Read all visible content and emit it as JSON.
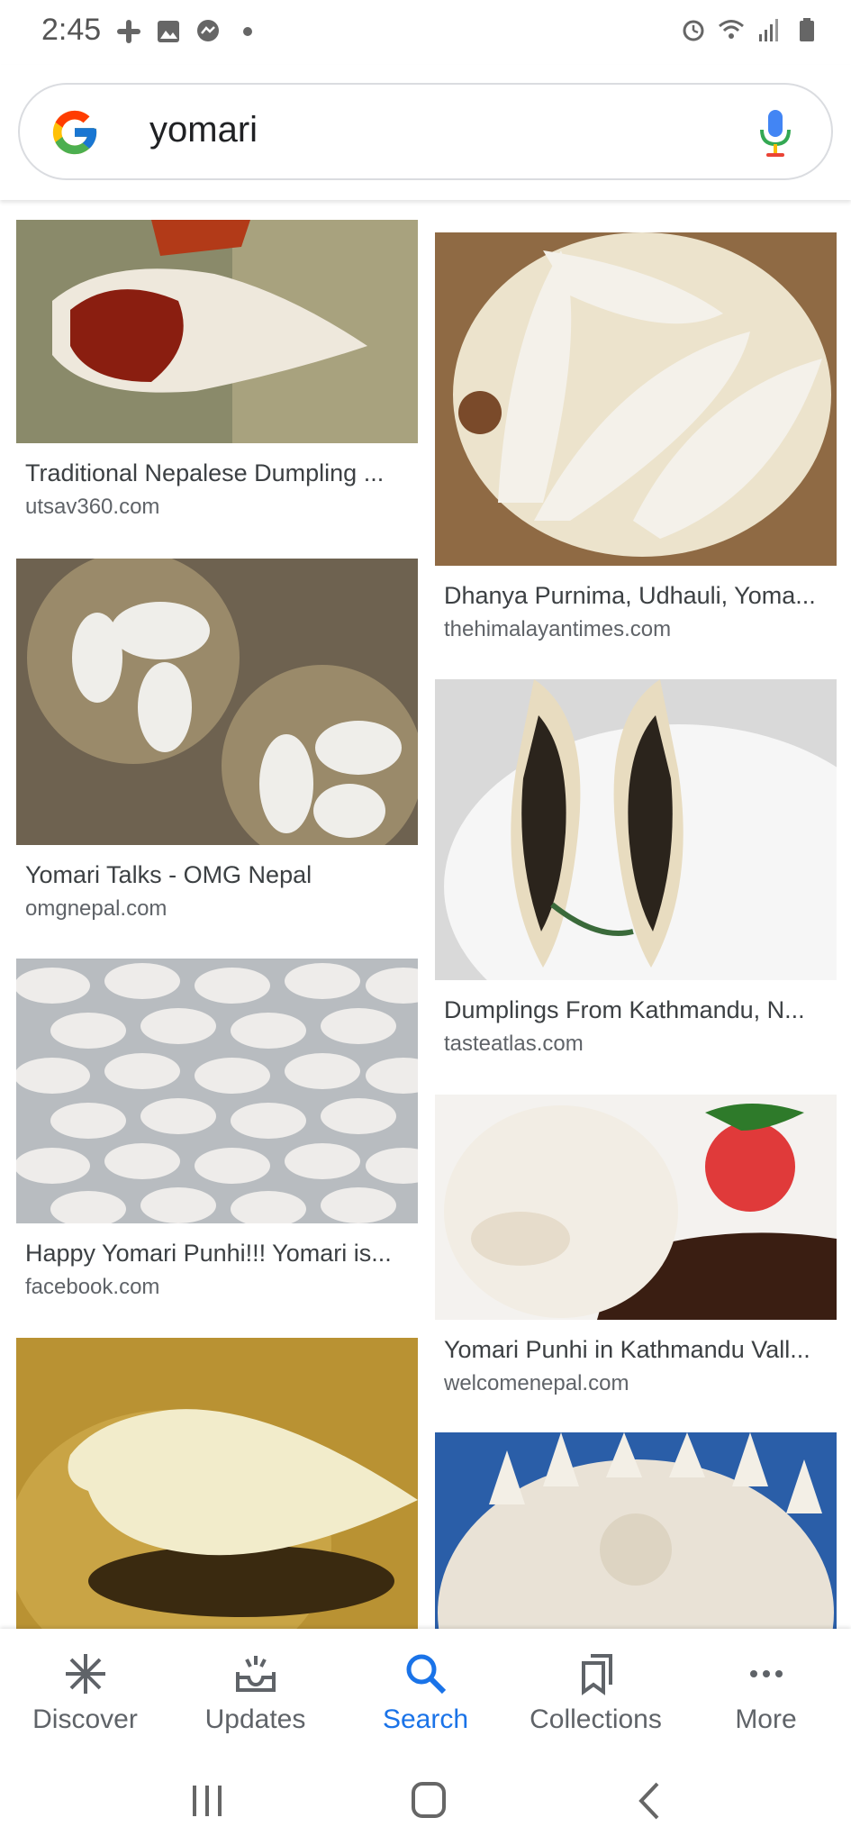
{
  "status_bar": {
    "time": "2:45",
    "left_icons": [
      "slack-icon",
      "gallery-icon",
      "messenger-icon",
      "dot-icon"
    ],
    "right_icons": [
      "alarm-icon",
      "wifi-icon",
      "signal-icon",
      "battery-icon"
    ]
  },
  "search": {
    "query": "yomari",
    "logo": "google-g-icon",
    "mic": "mic-icon"
  },
  "results": {
    "left": [
      {
        "title": "Traditional Nepalese Dumpling ...",
        "source": "utsav360.com"
      },
      {
        "title": "Yomari Talks - OMG Nepal",
        "source": "omgnepal.com"
      },
      {
        "title": "Happy Yomari Punhi!!! Yomari is...",
        "source": "facebook.com"
      },
      {
        "title": "",
        "source": ""
      }
    ],
    "right": [
      {
        "title": "Dhanya Purnima, Udhauli, Yoma...",
        "source": "thehimalayantimes.com"
      },
      {
        "title": "Dumplings From Kathmandu, N...",
        "source": "tasteatlas.com"
      },
      {
        "title": "Yomari Punhi in Kathmandu Vall...",
        "source": "welcomenepal.com"
      },
      {
        "title": "",
        "source": ""
      }
    ]
  },
  "bottom_nav": {
    "items": [
      {
        "label": "Discover",
        "icon": "asterisk-icon"
      },
      {
        "label": "Updates",
        "icon": "inbox-icon"
      },
      {
        "label": "Search",
        "icon": "search-icon"
      },
      {
        "label": "Collections",
        "icon": "bookmarks-icon"
      },
      {
        "label": "More",
        "icon": "more-dots-icon"
      }
    ],
    "active": "Search"
  },
  "system_nav": [
    "recents-icon",
    "home-icon",
    "back-icon"
  ],
  "colors": {
    "accent": "#1a73e8",
    "text_primary": "#3c4043",
    "text_secondary": "#5f6368"
  }
}
